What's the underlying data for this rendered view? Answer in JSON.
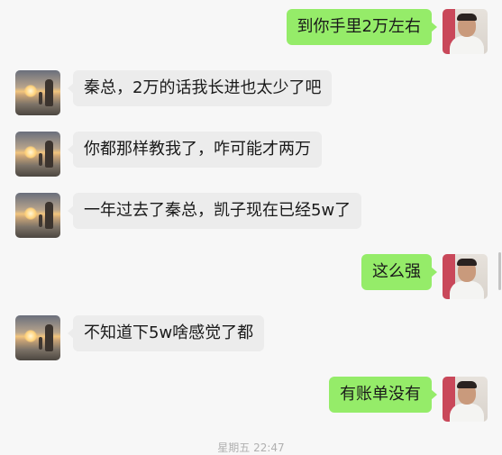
{
  "messages": [
    {
      "side": "right",
      "text": "到你手里2万左右"
    },
    {
      "side": "left",
      "text": "秦总，2万的话我长进也太少了吧"
    },
    {
      "side": "left",
      "text": "你都那样教我了，咋可能才两万"
    },
    {
      "side": "left",
      "text": "一年过去了秦总，凯子现在已经5w了"
    },
    {
      "side": "right",
      "text": "这么强"
    },
    {
      "side": "left",
      "text": "不知道下5w啥感觉了都"
    },
    {
      "side": "right",
      "text": "有账单没有"
    }
  ],
  "timestamp": "星期五 22:47",
  "colors": {
    "sent_bubble": "#95ec69",
    "received_bubble": "#ececec",
    "background": "#f7f7f7"
  }
}
